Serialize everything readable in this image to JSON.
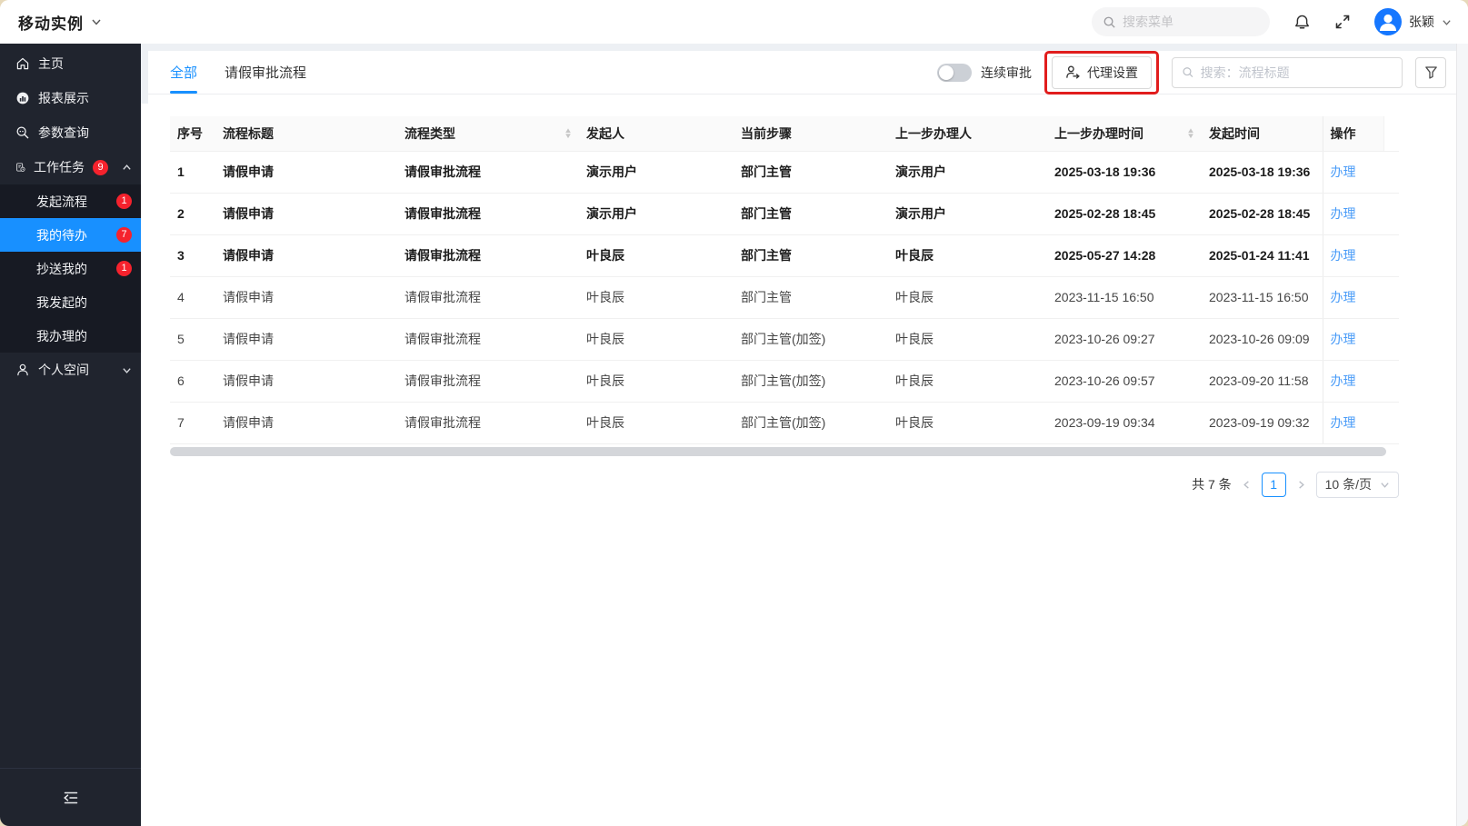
{
  "topbar": {
    "app_title": "移动实例",
    "menu_search_placeholder": "搜索菜单",
    "user_name": "张颖"
  },
  "sidebar": {
    "items": [
      {
        "label": "主页"
      },
      {
        "label": "报表展示"
      },
      {
        "label": "参数查询"
      },
      {
        "label": "工作任务",
        "badge": "9"
      }
    ],
    "task_children": [
      {
        "label": "发起流程",
        "badge": "1"
      },
      {
        "label": "我的待办",
        "badge": "7"
      },
      {
        "label": "抄送我的",
        "badge": "1"
      },
      {
        "label": "我发起的"
      },
      {
        "label": "我办理的"
      }
    ],
    "personal": {
      "label": "个人空间"
    }
  },
  "tabs": {
    "all": "全部",
    "leave": "请假审批流程"
  },
  "toolbar": {
    "toggle_label": "连续审批",
    "agent_button": "代理设置",
    "search_placeholder": "搜索：流程标题"
  },
  "table": {
    "columns": [
      "序号",
      "流程标题",
      "流程类型",
      "发起人",
      "当前步骤",
      "上一步办理人",
      "上一步办理时间",
      "发起时间",
      "操作"
    ],
    "rows": [
      {
        "no": "1",
        "title": "请假申请",
        "type": "请假审批流程",
        "initiator": "演示用户",
        "step": "部门主管",
        "prev_handler": "演示用户",
        "prev_time": "2025-03-18 19:36",
        "start_time": "2025-03-18 19:36",
        "action": "办理"
      },
      {
        "no": "2",
        "title": "请假申请",
        "type": "请假审批流程",
        "initiator": "演示用户",
        "step": "部门主管",
        "prev_handler": "演示用户",
        "prev_time": "2025-02-28 18:45",
        "start_time": "2025-02-28 18:45",
        "action": "办理"
      },
      {
        "no": "3",
        "title": "请假申请",
        "type": "请假审批流程",
        "initiator": "叶良辰",
        "step": "部门主管",
        "prev_handler": "叶良辰",
        "prev_time": "2025-05-27 14:28",
        "start_time": "2025-01-24 11:41",
        "action": "办理"
      },
      {
        "no": "4",
        "title": "请假申请",
        "type": "请假审批流程",
        "initiator": "叶良辰",
        "step": "部门主管",
        "prev_handler": "叶良辰",
        "prev_time": "2023-11-15 16:50",
        "start_time": "2023-11-15 16:50",
        "action": "办理"
      },
      {
        "no": "5",
        "title": "请假申请",
        "type": "请假审批流程",
        "initiator": "叶良辰",
        "step": "部门主管(加签)",
        "prev_handler": "叶良辰",
        "prev_time": "2023-10-26 09:27",
        "start_time": "2023-10-26 09:09",
        "action": "办理"
      },
      {
        "no": "6",
        "title": "请假申请",
        "type": "请假审批流程",
        "initiator": "叶良辰",
        "step": "部门主管(加签)",
        "prev_handler": "叶良辰",
        "prev_time": "2023-10-26 09:57",
        "start_time": "2023-09-20 11:58",
        "action": "办理"
      },
      {
        "no": "7",
        "title": "请假申请",
        "type": "请假审批流程",
        "initiator": "叶良辰",
        "step": "部门主管(加签)",
        "prev_handler": "叶良辰",
        "prev_time": "2023-09-19 09:34",
        "start_time": "2023-09-19 09:32",
        "action": "办理"
      }
    ]
  },
  "pagination": {
    "total": "共 7 条",
    "current_page": "1",
    "page_size": "10 条/页"
  },
  "colors": {
    "primary": "#1890ff",
    "badge_red": "#f5222d",
    "annotation_red": "#e11d1d",
    "link_blue": "#4a9cf8",
    "sidebar_bg": "#20242e"
  }
}
